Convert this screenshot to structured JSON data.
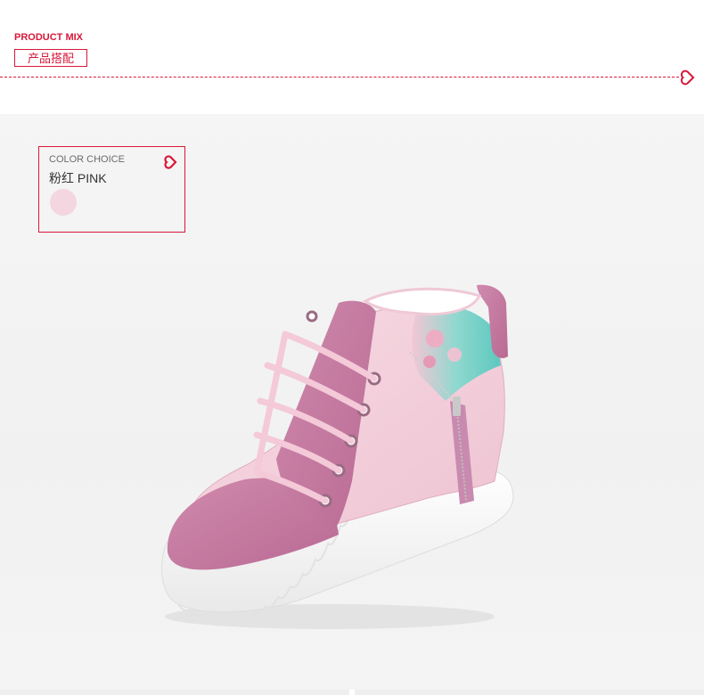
{
  "header": {
    "title": "PRODUCT MIX",
    "subtitle": "产品搭配"
  },
  "color_choice": {
    "label": "COLOR CHOICE",
    "name": "粉红 PINK",
    "swatch_color": "#f3d6df"
  },
  "colors": {
    "accent": "#d8183a",
    "background": "#f3f3f3"
  },
  "product_image": {
    "subject": "pink high-top sneaker with floral panel, side zipper and white platform sole"
  }
}
